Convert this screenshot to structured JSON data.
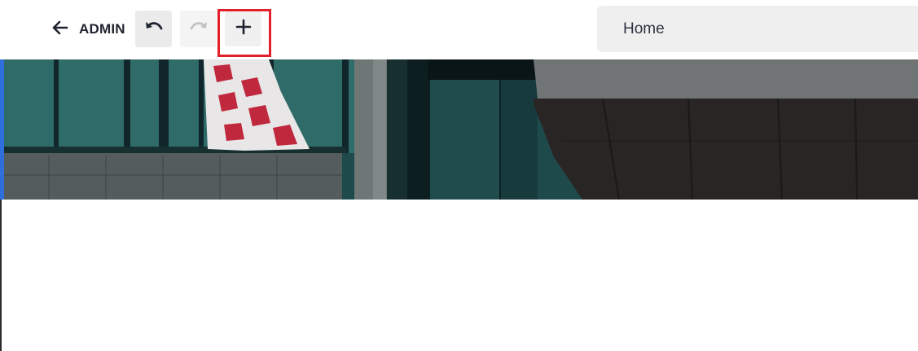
{
  "toolbar": {
    "back_icon": "arrow-left-icon",
    "title": "ADMIN",
    "undo_icon": "undo-icon",
    "redo_icon": "redo-icon",
    "add_icon": "plus-icon"
  },
  "page_selector": {
    "value": "Home"
  },
  "colors": {
    "highlight": "#e3202a",
    "selection_bar": "#2f6fdb",
    "button_bg": "#ebebeb"
  }
}
